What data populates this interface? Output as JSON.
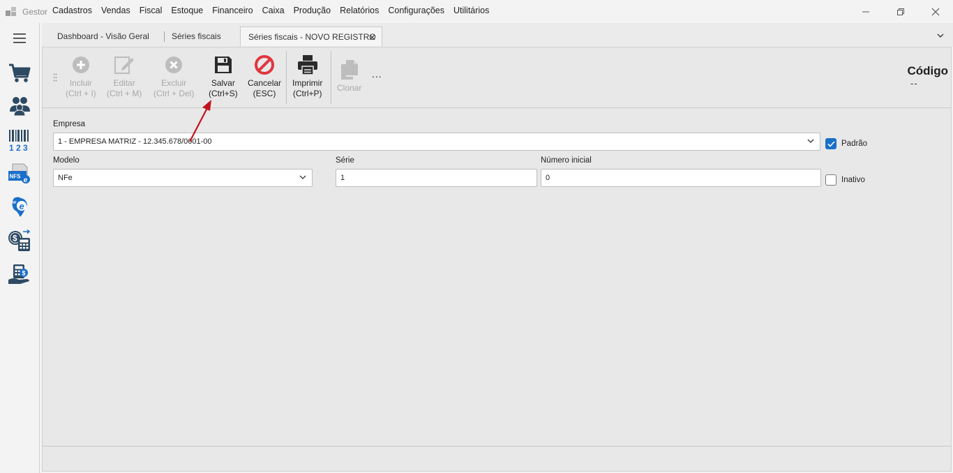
{
  "app": {
    "name": "Gestor"
  },
  "menu": [
    "Cadastros",
    "Vendas",
    "Fiscal",
    "Estoque",
    "Financeiro",
    "Caixa",
    "Produção",
    "Relatórios",
    "Configurações",
    "Utilitários"
  ],
  "tabs": [
    {
      "label": "Dashboard - Visão Geral"
    },
    {
      "label": "Séries fiscais"
    },
    {
      "label": "Séries fiscais - NOVO REGISTRO",
      "active": true
    }
  ],
  "toolbar": {
    "incluir": {
      "label": "Incluir",
      "shortcut": "(Ctrl + I)"
    },
    "editar": {
      "label": "Editar",
      "shortcut": "(Ctrl + M)"
    },
    "excluir": {
      "label": "Excluir",
      "shortcut": "(Ctrl + Del)"
    },
    "salvar": {
      "label": "Salvar",
      "shortcut": "(Ctrl+S)"
    },
    "cancelar": {
      "label": "Cancelar",
      "shortcut": "(ESC)"
    },
    "imprimir": {
      "label": "Imprimir",
      "shortcut": "(Ctrl+P)"
    },
    "clonar": {
      "label": "Clonar"
    },
    "more": "..."
  },
  "codigo": {
    "label": "Código",
    "value": "--"
  },
  "form": {
    "empresa": {
      "label": "Empresa",
      "value": "1 - EMPRESA MATRIZ - 12.345.678/0001-00"
    },
    "padrao": {
      "label": "Padrão",
      "checked": true
    },
    "modelo": {
      "label": "Modelo",
      "value": "NFe"
    },
    "serie": {
      "label": "Série",
      "value": "1"
    },
    "numero_inicial": {
      "label": "Número inicial",
      "value": "0"
    },
    "inativo": {
      "label": "Inativo",
      "checked": false
    }
  },
  "rail_icons": [
    "menu-icon",
    "cart-icon",
    "people-icon",
    "barcode-icon",
    "nfse-icon",
    "nfe-icon",
    "finance-calculator-icon",
    "cash-hand-icon"
  ],
  "colors": {
    "accent": "#1a6fc9",
    "cancel_red": "#e0353d",
    "annotation_arrow": "#c4121b"
  }
}
